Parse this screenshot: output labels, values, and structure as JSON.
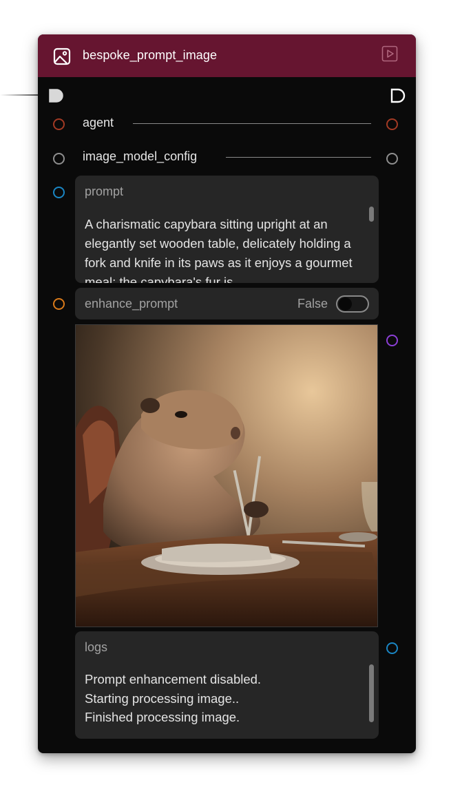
{
  "node": {
    "title": "bespoke_prompt_image",
    "header_color": "#661530",
    "header_icon": "image-icon",
    "run_icon": "play-icon"
  },
  "inputs": [
    {
      "label": "agent",
      "color": "#a33a24"
    },
    {
      "label": "image_model_config",
      "color": "#8f8f8f"
    }
  ],
  "prompt": {
    "label": "prompt",
    "socket_color": "#1a86c4",
    "value": "A charismatic capybara sitting upright at an elegantly set wooden table, delicately holding a fork and knife in its paws as it enjoys a gourmet meal; the capybara's fur is"
  },
  "enhance_prompt": {
    "label": "enhance_prompt",
    "socket_color": "#d97a1a",
    "value": "False",
    "enabled": false
  },
  "image_output": {
    "socket_color": "#8c3fd6",
    "icon": "capybara-dining-image"
  },
  "logs": {
    "label": "logs",
    "socket_color": "#1a86c4",
    "lines": "Prompt enhancement disabled.\nStarting processing image..\nFinished processing image."
  }
}
